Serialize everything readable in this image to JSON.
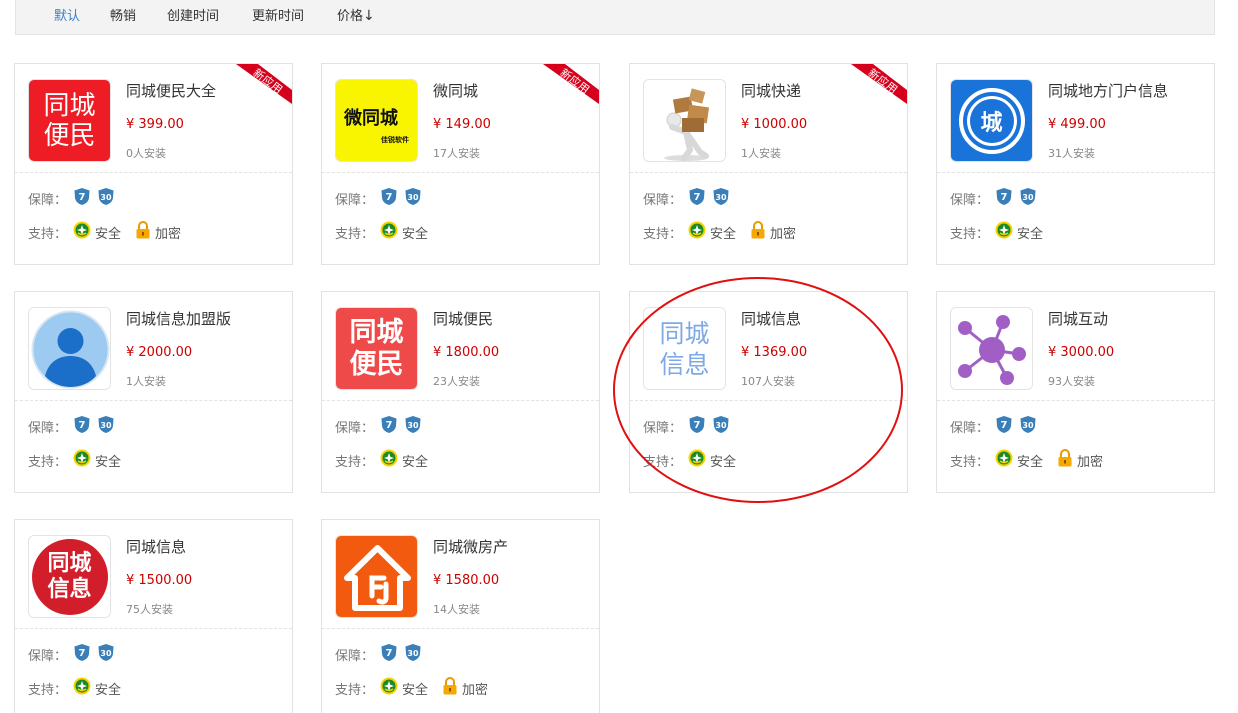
{
  "sort": {
    "items": [
      {
        "label": "默认",
        "active": true
      },
      {
        "label": "畅销",
        "active": false
      },
      {
        "label": "创建时间",
        "active": false
      },
      {
        "label": "更新时间",
        "active": false
      },
      {
        "label": "价格",
        "active": false
      }
    ],
    "price_arrow": "↓"
  },
  "labels": {
    "guarantee": "保障：",
    "support": "支持：",
    "safe": "安全",
    "encrypt": "加密",
    "badge_7": "7",
    "badge_30": "30",
    "new_ribbon": "新应用"
  },
  "colors": {
    "price": "#cc0000",
    "ribbon": "#d6001c",
    "shield": "#3a7fb8",
    "annotation": "#e01010",
    "active_sort": "#3c7fc6"
  },
  "apps": [
    {
      "name": "同城便民大全",
      "price": "¥ 399.00",
      "installs": "0人安装",
      "is_new": true,
      "encrypt": true,
      "icon": "red-tongcheng-bianmin-icon",
      "icon_text": [
        "同城",
        "便民"
      ]
    },
    {
      "name": "微同城",
      "price": "¥ 149.00",
      "installs": "17人安装",
      "is_new": true,
      "encrypt": false,
      "icon": "yellow-weitongcheng-icon",
      "icon_text": [
        "微同城",
        "佳锐软件"
      ]
    },
    {
      "name": "同城快递",
      "price": "¥ 1000.00",
      "installs": "1人安装",
      "is_new": true,
      "encrypt": true,
      "icon": "courier-boxes-icon",
      "icon_text": []
    },
    {
      "name": "同城地方门户信息",
      "price": "¥ 499.00",
      "installs": "31人安装",
      "is_new": false,
      "encrypt": false,
      "icon": "blue-city-circle-icon",
      "icon_text": [
        "城"
      ]
    },
    {
      "name": "同城信息加盟版",
      "price": "¥ 2000.00",
      "installs": "1人安装",
      "is_new": false,
      "encrypt": false,
      "icon": "user-avatar-icon",
      "icon_text": []
    },
    {
      "name": "同城便民",
      "price": "¥ 1800.00",
      "installs": "23人安装",
      "is_new": false,
      "encrypt": false,
      "icon": "pink-tongcheng-bianmin-icon",
      "icon_text": [
        "同城",
        "便民"
      ]
    },
    {
      "name": "同城信息",
      "price": "¥ 1369.00",
      "installs": "107人安装",
      "is_new": false,
      "encrypt": false,
      "icon": "light-blue-tongcheng-xinxi-icon",
      "icon_text": [
        "同城",
        "信息"
      ]
    },
    {
      "name": "同城互动",
      "price": "¥ 3000.00",
      "installs": "93人安装",
      "is_new": false,
      "encrypt": true,
      "icon": "purple-network-icon",
      "icon_text": []
    },
    {
      "name": "同城信息",
      "price": "¥ 1500.00",
      "installs": "75人安装",
      "is_new": false,
      "encrypt": false,
      "icon": "red-circle-tongcheng-xinxi-icon",
      "icon_text": [
        "同城",
        "信息"
      ]
    },
    {
      "name": "同城微房产",
      "price": "¥ 1580.00",
      "installs": "14人安装",
      "is_new": false,
      "encrypt": true,
      "icon": "orange-house-icon",
      "icon_text": []
    }
  ]
}
